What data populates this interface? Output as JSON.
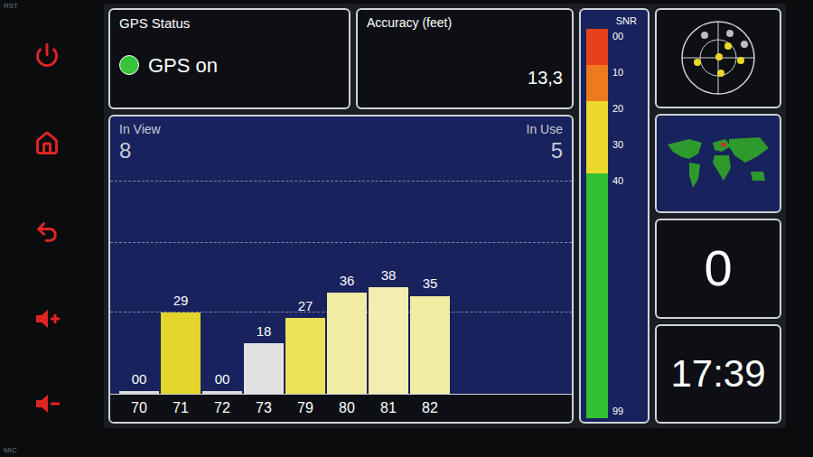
{
  "bezel": {
    "top_label": "RST",
    "bottom_label": "MIC"
  },
  "gps_status": {
    "title": "GPS Status",
    "status": "GPS on",
    "on": true
  },
  "accuracy": {
    "title": "Accuracy (feet)",
    "value": "13,3"
  },
  "chart": {
    "in_view_label": "In View",
    "in_view": "8",
    "in_use_label": "In Use",
    "in_use": "5",
    "bars": [
      {
        "prn": "70",
        "snr": 0,
        "reading": "00",
        "color": "#d9d9d9"
      },
      {
        "prn": "71",
        "snr": 29,
        "reading": "29",
        "color": "#e3d52b"
      },
      {
        "prn": "72",
        "snr": 0,
        "reading": "00",
        "color": "#d9d9d9"
      },
      {
        "prn": "73",
        "snr": 18,
        "reading": "18",
        "color": "#e2e2e2"
      },
      {
        "prn": "79",
        "snr": 27,
        "reading": "27",
        "color": "#ece25a"
      },
      {
        "prn": "80",
        "snr": 36,
        "reading": "36",
        "color": "#f1eca4"
      },
      {
        "prn": "81",
        "snr": 38,
        "reading": "38",
        "color": "#f3eeb0"
      },
      {
        "prn": "82",
        "snr": 35,
        "reading": "35",
        "color": "#f1eca4"
      }
    ]
  },
  "snr_scale": {
    "title": "SNR",
    "end_label": "99",
    "segments": [
      {
        "label": "00",
        "color": "#e8401c"
      },
      {
        "label": "10",
        "color": "#ee7a1e"
      },
      {
        "label": "20",
        "color": "#e9d92a"
      },
      {
        "label": "30",
        "color": "#e9d92a"
      },
      {
        "label": "40",
        "color": "#2fc12f"
      }
    ]
  },
  "speed": "0",
  "time": "17:39"
}
